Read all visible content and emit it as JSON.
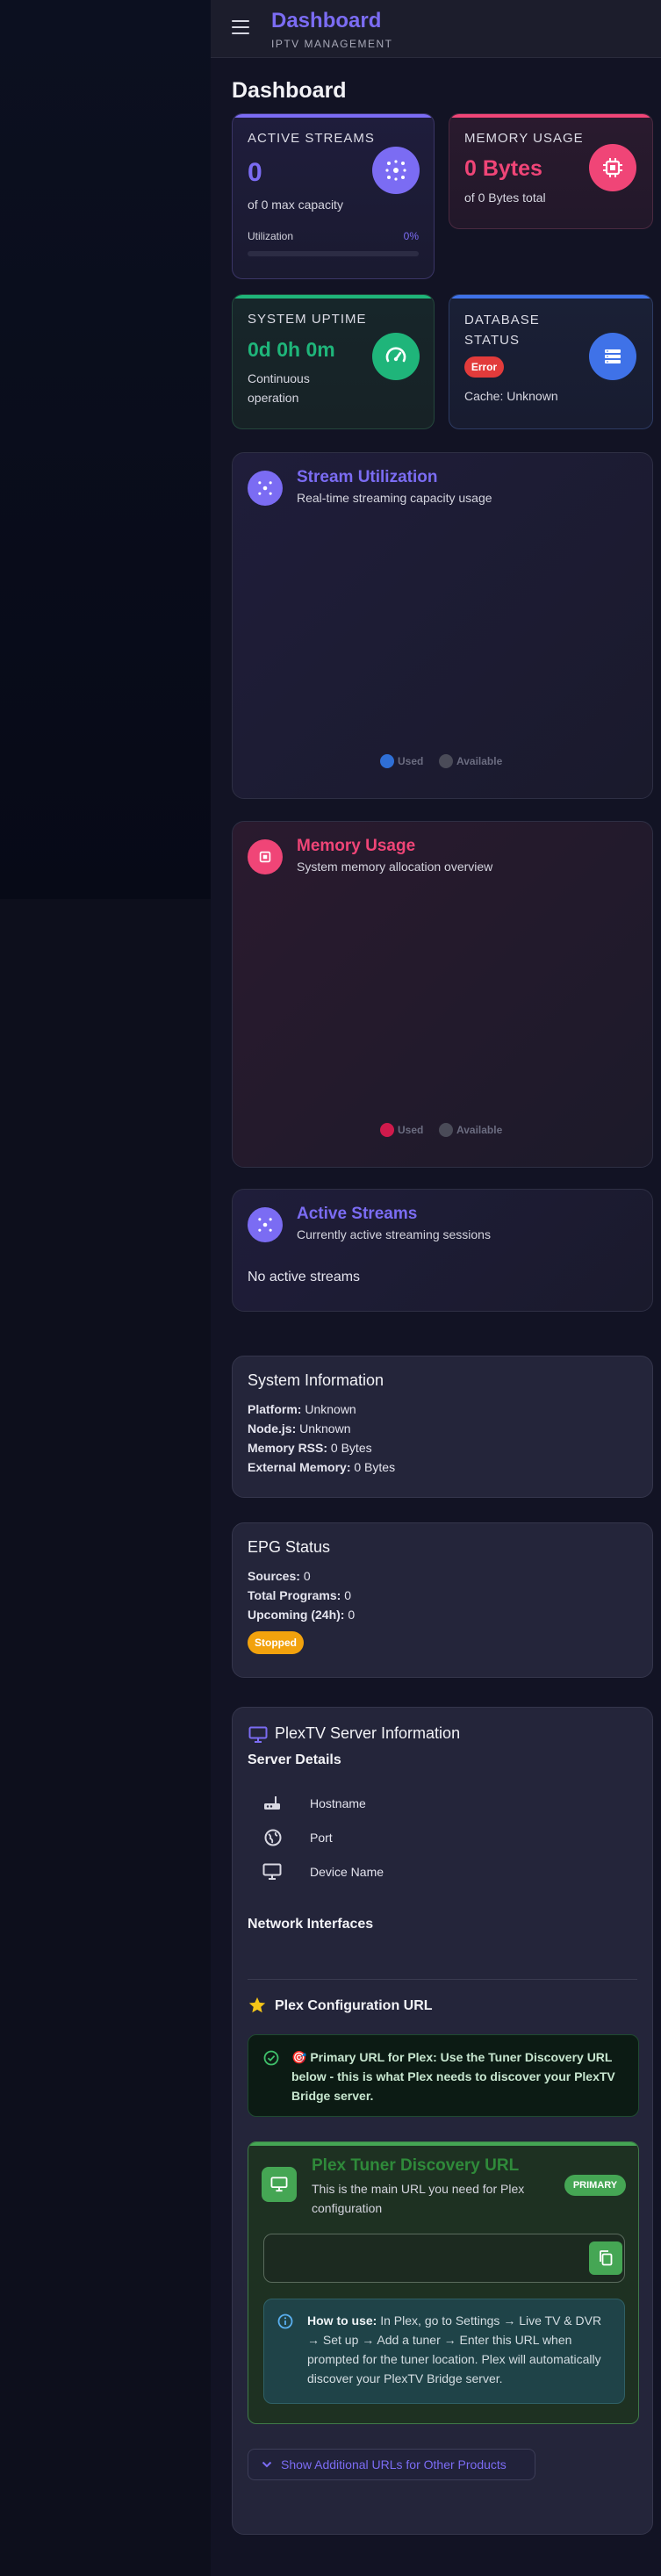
{
  "app": {
    "title": "Dashboard",
    "subtitle": "IPTV MANAGEMENT",
    "page_title": "Dashboard"
  },
  "stats": {
    "active_streams": {
      "label": "ACTIVE STREAMS",
      "value": "0",
      "sub": "of 0 max capacity",
      "util_label": "Utilization",
      "util_value": "0%",
      "utilization_fraction": 0,
      "icon": "broadcast-icon",
      "color": "#7b6cf3"
    },
    "memory": {
      "label": "MEMORY USAGE",
      "value": "0 Bytes",
      "sub": "of 0 Bytes total",
      "icon": "memory-chip-icon",
      "color": "#f04577"
    },
    "uptime": {
      "label": "SYSTEM UPTIME",
      "value": "0d 0h 0m",
      "sub1": "Continuous",
      "sub2": "operation",
      "icon": "speedometer-icon",
      "color": "#1fb57a"
    },
    "database": {
      "label1": "DATABASE",
      "label2": "STATUS",
      "badge": "Error",
      "sub": "Cache: Unknown",
      "icon": "database-icon",
      "color": "#3f72e8"
    }
  },
  "stream_utilization": {
    "title": "Stream Utilization",
    "subtitle": "Real-time streaming capacity usage",
    "legend_used": "Used",
    "legend_available": "Available"
  },
  "memory_usage": {
    "title": "Memory Usage",
    "subtitle": "System memory allocation overview",
    "legend_used": "Used",
    "legend_available": "Available"
  },
  "active_streams": {
    "title": "Active Streams",
    "subtitle": "Currently active streaming sessions",
    "empty": "No active streams"
  },
  "system_info": {
    "title": "System Information",
    "rows": [
      {
        "key": "Platform:",
        "value": "Unknown"
      },
      {
        "key": "Node.js:",
        "value": "Unknown"
      },
      {
        "key": "Memory RSS:",
        "value": "0 Bytes"
      },
      {
        "key": "External Memory:",
        "value": "0 Bytes"
      }
    ]
  },
  "epg": {
    "title": "EPG Status",
    "rows": [
      {
        "key": "Sources:",
        "value": "0"
      },
      {
        "key": "Total Programs:",
        "value": "0"
      },
      {
        "key": "Upcoming (24h):",
        "value": "0"
      }
    ],
    "status_badge": "Stopped"
  },
  "plextv": {
    "title": "PlexTV Server Information",
    "server_details": "Server Details",
    "details": [
      {
        "icon": "router-icon",
        "label": "Hostname"
      },
      {
        "icon": "globe-icon",
        "label": "Port"
      },
      {
        "icon": "monitor-icon",
        "label": "Device Name"
      }
    ],
    "network_interfaces": "Network Interfaces",
    "plex_config_title": "Plex Configuration URL",
    "alert_text": "🎯 Primary URL for Plex: Use the Tuner Discovery URL below - this is what Plex needs to discover your PlexTV Bridge server.",
    "tuner": {
      "title": "Plex Tuner Discovery URL",
      "subtitle": "This is the main URL you need for Plex configuration",
      "badge": "PRIMARY",
      "url_value": "",
      "how_to_bold": "How to use:",
      "how_to_text": " In Plex, go to Settings → Live TV & DVR → Set up → Add a tuner → Enter this URL when prompted for the tuner location. Plex will automatically discover your PlexTV Bridge server."
    },
    "more_urls_button": "Show Additional URLs for Other Products"
  }
}
